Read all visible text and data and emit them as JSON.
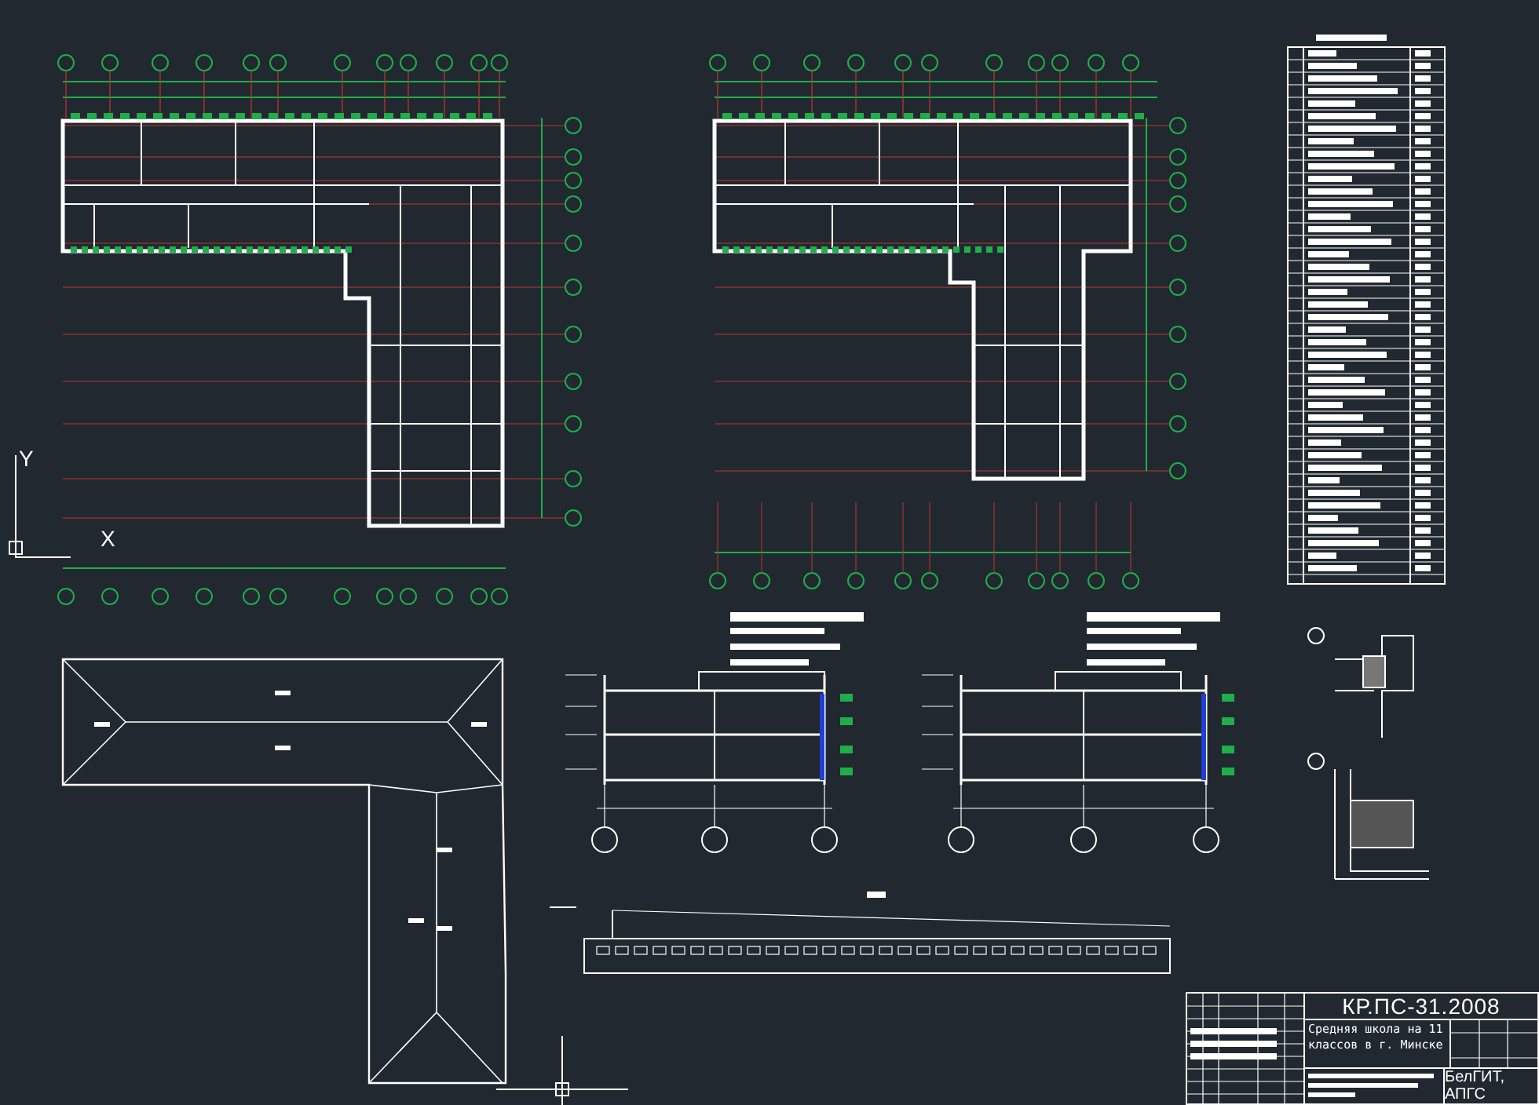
{
  "title_block": {
    "code": "КР.ПС-31.2008",
    "description": "Средняя школа на 11 классов в г. Минске",
    "organization": "БелГИТ, АПГС"
  },
  "ucs": {
    "y_label": "Y",
    "x_label": "X"
  }
}
